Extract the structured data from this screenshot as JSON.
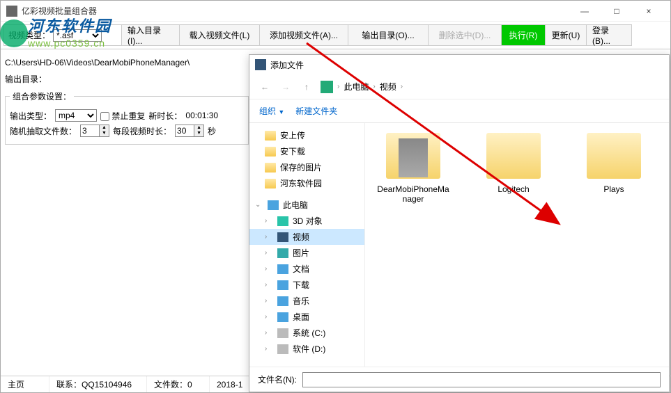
{
  "app": {
    "title": "亿彩视频批量组合器",
    "win_min": "—",
    "win_max": "□",
    "win_close": "×"
  },
  "toolbar": {
    "video_type_label": "视频类型：",
    "video_type_value": "*.asf",
    "input_dir": "输入目录(I)...",
    "load_video": "载入视频文件(L)",
    "add_video": "添加视频文件(A)...",
    "output_dir": "输出目录(O)...",
    "delete_sel": "删除选中(D)...",
    "execute": "执行(R)",
    "update": "更新(U)",
    "login": "登录(B)..."
  },
  "left": {
    "path": "C:\\Users\\HD-06\\Videos\\DearMobiPhoneManager\\",
    "outdir_label": "输出目录：",
    "group_title": "组合参数设置：",
    "out_type_label": "输出类型：",
    "out_type_value": "mp4",
    "no_repeat": "禁止重复",
    "new_dur_label": "新时长：",
    "new_dur_value": "00:01:30",
    "rand_count_label": "随机抽取文件数：",
    "rand_count_value": "3",
    "seg_dur_label": "每段视频时长：",
    "seg_dur_value": "30",
    "seg_dur_unit": "秒"
  },
  "dialog": {
    "title": "添加文件",
    "crumb_pc": "此电脑",
    "crumb_video": "视频",
    "organize": "组织",
    "newfolder": "新建文件夹",
    "tree": {
      "q1": "安上传",
      "q2": "安下载",
      "q3": "保存的图片",
      "q4": "河东软件园",
      "pc": "此电脑",
      "n3d": "3D 对象",
      "video": "视频",
      "pics": "图片",
      "docs": "文档",
      "dl": "下载",
      "music": "音乐",
      "desk": "桌面",
      "sysc": "系统 (C:)",
      "softd": "软件 (D:)"
    },
    "items": {
      "i1": "DearMobiPhoneManager",
      "i2": "Logitech",
      "i3": "Plays"
    },
    "fn_label": "文件名(N):"
  },
  "status": {
    "home": "主页",
    "contact": "联系：QQ15104946",
    "filecount": "文件数：0",
    "date": "2018-1"
  },
  "watermark": {
    "t1": "河东软件园",
    "t2": "www.pc0359.cn"
  }
}
